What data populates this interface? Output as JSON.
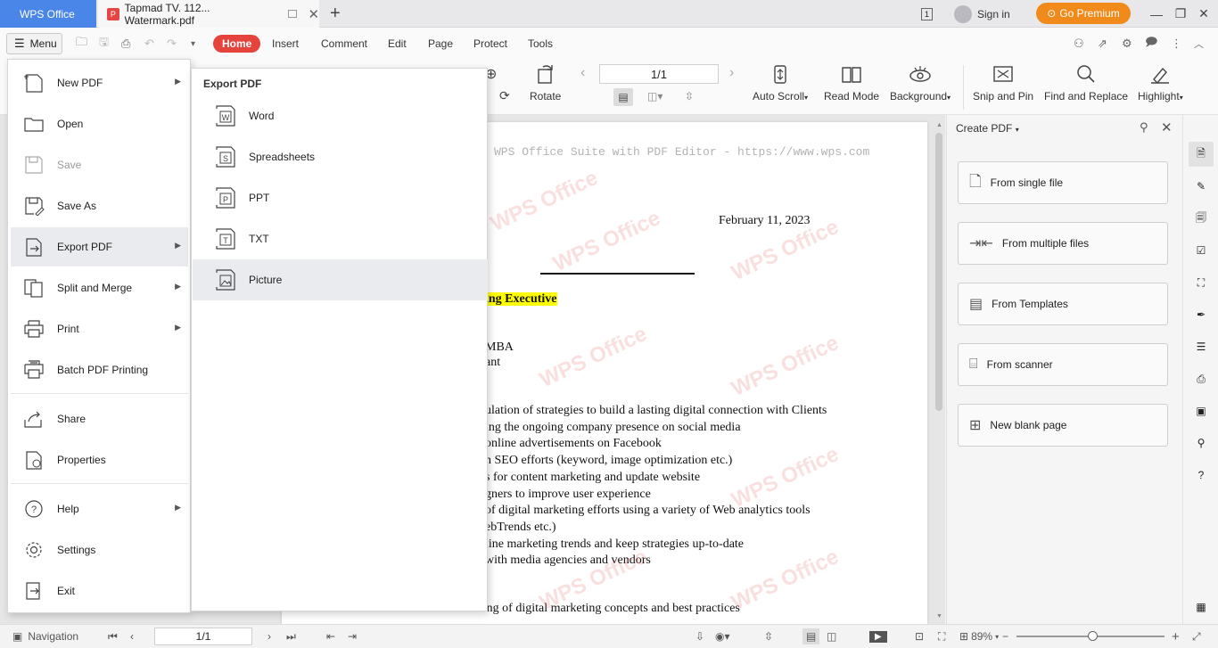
{
  "titlebar": {
    "app_tab": "WPS Office",
    "doc_tab": "Tapmad TV. 112... Watermark.pdf",
    "sign_in": "Sign in",
    "premium": "Go Premium"
  },
  "menubar": {
    "menu_label": "Menu",
    "tabs": [
      "Home",
      "Insert",
      "Comment",
      "Edit",
      "Page",
      "Protect",
      "Tools"
    ],
    "active_tab": "Home"
  },
  "ribbon": {
    "rotate": "Rotate",
    "page_value": "1/1",
    "auto_scroll": "Auto Scroll",
    "read_mode": "Read Mode",
    "background": "Background",
    "snip_and_pin": "Snip and Pin",
    "find_and_replace": "Find and Replace",
    "highlight": "Highlight"
  },
  "main_menu": {
    "items": [
      {
        "label": "New PDF",
        "icon": "new-pdf-icon",
        "submenu": true
      },
      {
        "label": "Open",
        "icon": "folder-icon"
      },
      {
        "label": "Save",
        "icon": "save-icon",
        "disabled": true
      },
      {
        "label": "Save As",
        "icon": "save-as-icon"
      },
      {
        "label": "Export PDF",
        "icon": "export-icon",
        "submenu": true,
        "active": true
      },
      {
        "label": "Split and Merge",
        "icon": "split-merge-icon",
        "submenu": true
      },
      {
        "label": "Print",
        "icon": "print-icon",
        "submenu": true
      },
      {
        "label": "Batch PDF Printing",
        "icon": "batch-print-icon"
      },
      {
        "label": "Share",
        "icon": "share-icon"
      },
      {
        "label": "Properties",
        "icon": "properties-icon"
      },
      {
        "label": "Help",
        "icon": "help-icon",
        "submenu": true
      },
      {
        "label": "Settings",
        "icon": "gear-icon"
      },
      {
        "label": "Exit",
        "icon": "exit-icon"
      }
    ]
  },
  "export_submenu": {
    "title": "Export PDF",
    "items": [
      "Word",
      "Spreadsheets",
      "PPT",
      "TXT",
      "Picture"
    ],
    "active": "Picture"
  },
  "document": {
    "header": "WPS Office Suite with PDF Editor - https://www.wps.com",
    "date": "February 11, 2023",
    "job_title": "ing Executive",
    "lines": [
      "MBA",
      "ant",
      "ulation of strategies to build a lasting digital connection with Clients",
      "ing the ongoing company presence on social media",
      "online advertisements on Facebook",
      "n SEO efforts (keyword, image optimization etc.)",
      "s for content marketing and update website",
      "gners to improve user experience",
      "of digital marketing efforts using a variety of Web analytics tools",
      "ebTrends etc.)",
      "line marketing trends and keep strategies up-to-date",
      "with media agencies and vendors",
      "Excellent understanding of digital marketing concepts and best practices"
    ],
    "watermark": "WPS Office"
  },
  "right_panel": {
    "title": "Create PDF",
    "buttons": [
      "From single file",
      "From multiple files",
      "From Templates",
      "From scanner",
      "New blank page"
    ]
  },
  "statusbar": {
    "navigation": "Navigation",
    "page_value": "1/1",
    "zoom": "89%"
  },
  "colors": {
    "accent_blue": "#4a86e8",
    "home_tab_red": "#e5443c",
    "premium_orange": "#f08a1b",
    "highlight_yellow": "#ffff00"
  }
}
